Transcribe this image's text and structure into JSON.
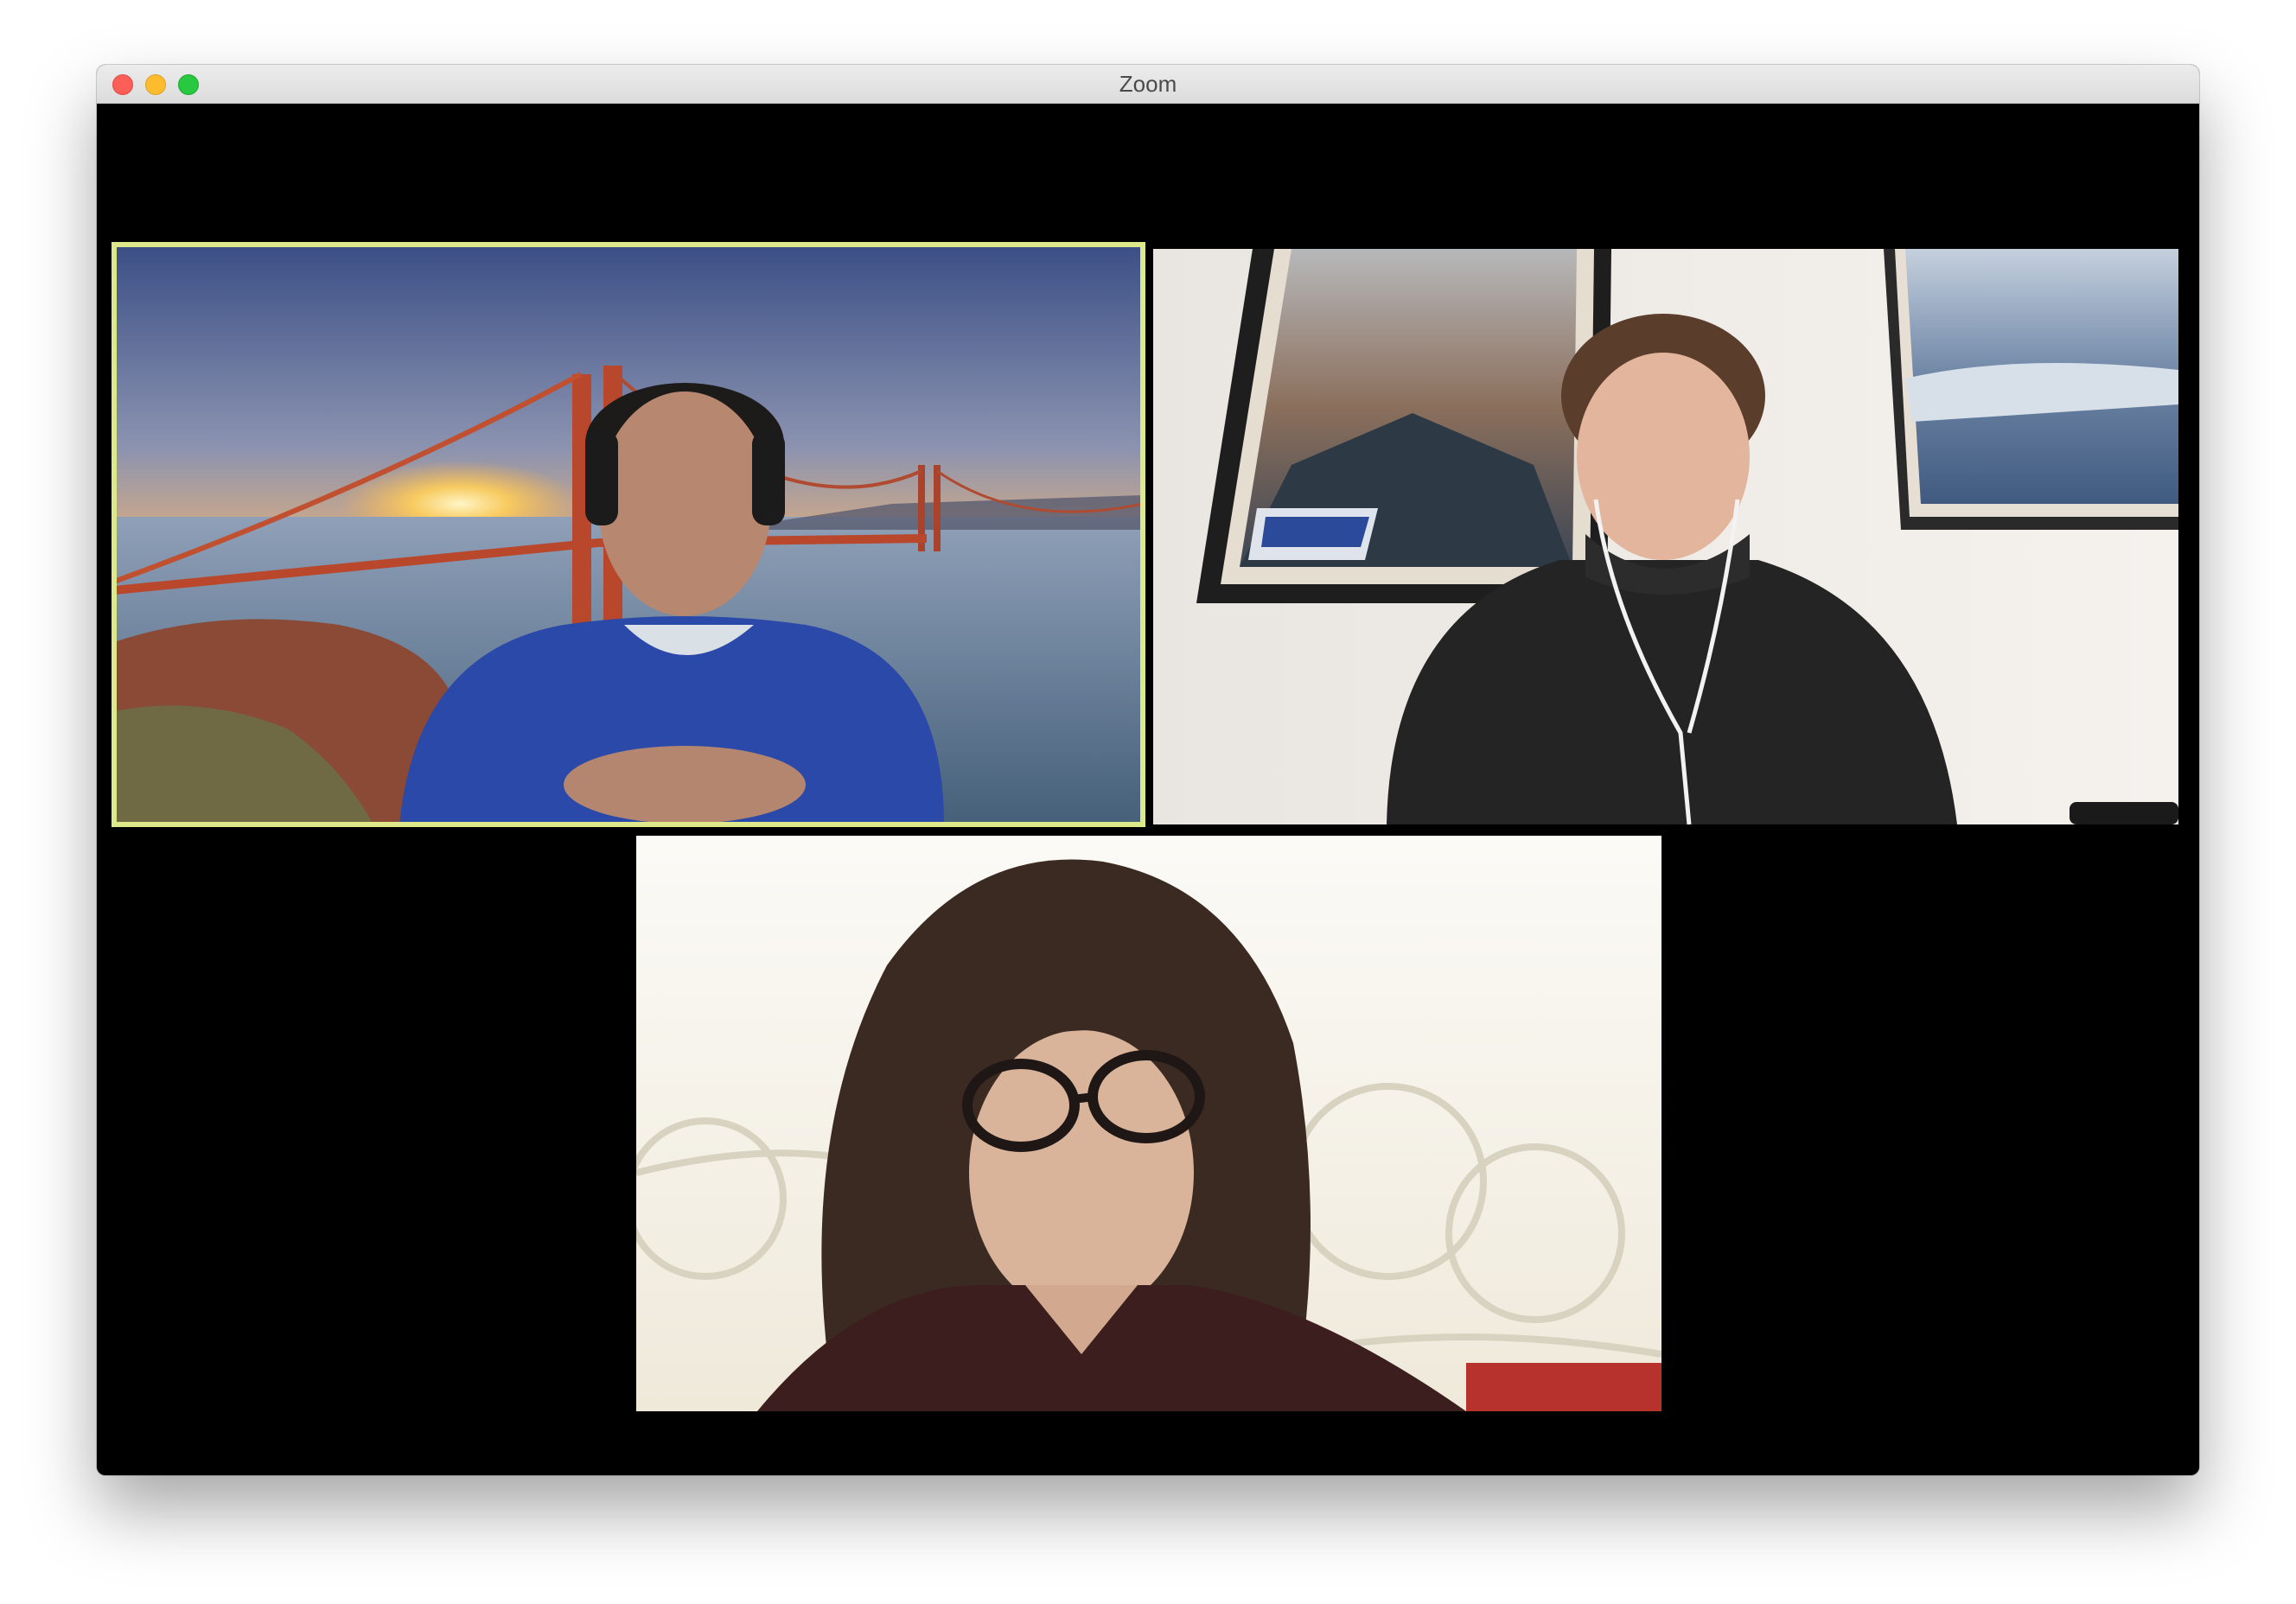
{
  "window": {
    "title": "Zoom"
  },
  "participants": [
    {
      "label": "",
      "active_speaker": true,
      "virtual_background": "golden-gate-sunset"
    },
    {
      "label": "",
      "active_speaker": false
    },
    {
      "label": "",
      "active_speaker": false
    }
  ],
  "colors": {
    "active_speaker_border": "#dde88a",
    "stage_background": "#000000"
  }
}
